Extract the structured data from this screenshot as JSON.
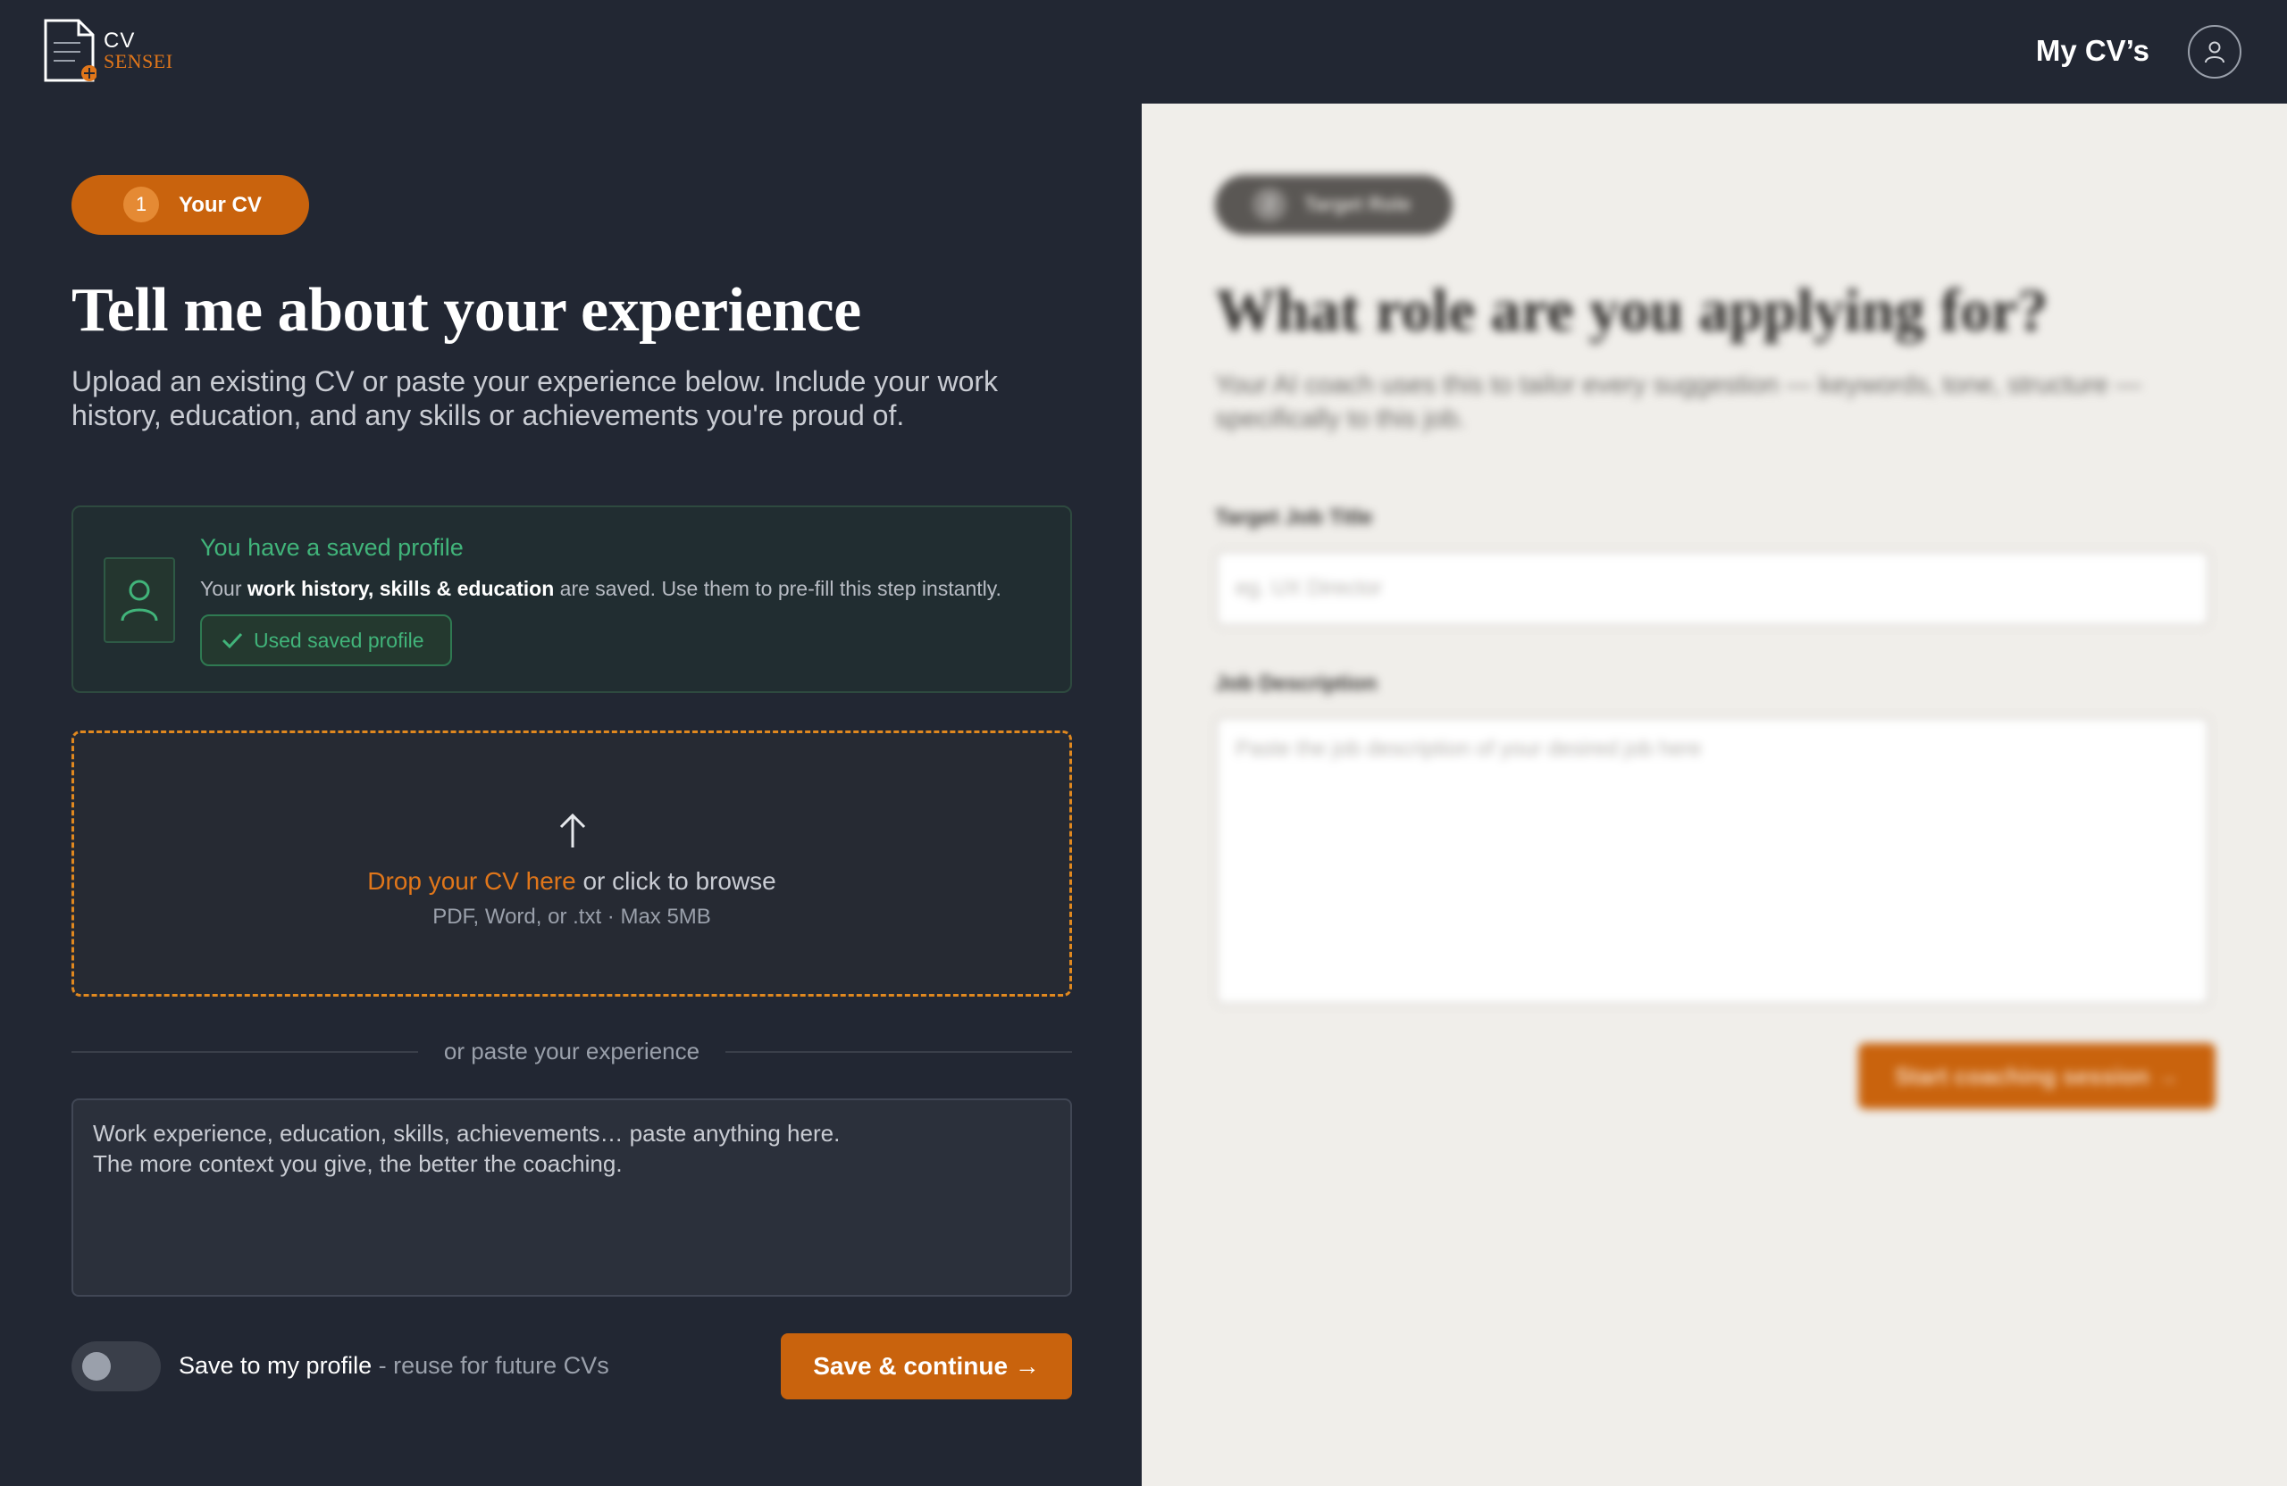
{
  "header": {
    "logo_line1": "CV",
    "logo_line2": "SENSEI",
    "nav_link": "My CV’s",
    "account_icon": "user-icon"
  },
  "colors": {
    "accent": "#c9630d",
    "success": "#41b47a",
    "background": "#222733",
    "right_panel_bg": "#f0eeea"
  },
  "step1": {
    "number": "1",
    "label": "Your CV",
    "title": "Tell me about your experience",
    "subtitle": "Upload an existing CV or paste your experience below. Include your work history, education, and any skills or achievements you're proud of."
  },
  "saved_profile": {
    "icon": "user-icon",
    "title": "You have a saved profile",
    "desc_prefix": "Your ",
    "desc_bold": "work history, skills & education",
    "desc_suffix": " are saved. Use them to pre-fill this step instantly.",
    "button_label": "Used saved profile",
    "button_icon": "check-icon"
  },
  "dropzone": {
    "icon": "upload-arrow-icon",
    "highlight": "Drop your CV here",
    "rest": " or click to browse",
    "formats": "PDF, Word, or .txt · Max 5MB"
  },
  "divider": {
    "text": "or paste your experience"
  },
  "paste": {
    "placeholder": "Work experience, education, skills, achievements… paste anything here.\nThe more context you give, the better the coaching."
  },
  "footer": {
    "toggle_on": false,
    "toggle_label": "Save to my profile",
    "toggle_muted": " - reuse for future CVs",
    "save_button": "Save & continue →"
  },
  "step2": {
    "number": "2",
    "label": "Target Role",
    "title": "What role are you applying for?",
    "subtitle": "Your AI coach uses this to tailor every suggestion — keywords, tone, structure — specifically to this job.",
    "job_title_label": "Target Job Title",
    "job_title_placeholder": "eg. UX Director",
    "job_desc_label": "Job Description",
    "job_desc_placeholder": "Paste the job description of your desired job here",
    "start_button": "Start coaching session →"
  }
}
